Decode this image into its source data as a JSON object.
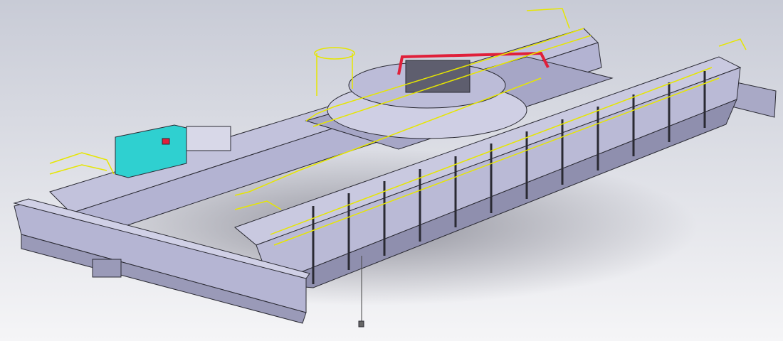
{
  "colors": {
    "background_top": "#c9ccd6",
    "background_bottom": "#f4f4f6",
    "steel": "#b9b9d6",
    "steel_dark": "#6e6e86",
    "edge": "#2a2a33",
    "railing": "#e6e600",
    "cabinet": "#2fd0d0",
    "cabinet_red": "#e0203a",
    "pipe_red": "#e0203a",
    "shadow": "#8a8a96"
  }
}
